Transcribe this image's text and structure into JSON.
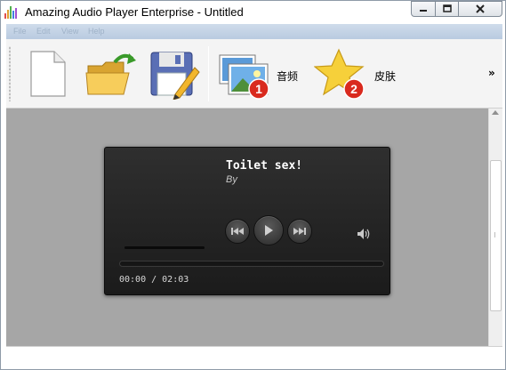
{
  "window": {
    "title": "Amazing Audio Player Enterprise - Untitled",
    "accent_color": "#cfdceb"
  },
  "menubar": {
    "items": [
      {
        "label": "File"
      },
      {
        "label": "Edit"
      },
      {
        "label": "View"
      },
      {
        "label": "Help"
      }
    ]
  },
  "toolbar": {
    "buttons": [
      {
        "icon": "new-document-icon"
      },
      {
        "icon": "open-folder-icon"
      },
      {
        "icon": "save-icon"
      },
      {
        "icon": "audio-images-icon",
        "badge": "1",
        "label": "音频"
      },
      {
        "icon": "skin-star-icon",
        "badge": "2",
        "label": "皮肤"
      }
    ],
    "overflow_label": "»"
  },
  "player": {
    "song_title": "Toilet sex!",
    "artist": "By",
    "current_time": "00:00",
    "separator": "/",
    "total_time": "02:03",
    "time_text": "00:00 / 02:03",
    "progress": 0,
    "volume": 1.0
  }
}
